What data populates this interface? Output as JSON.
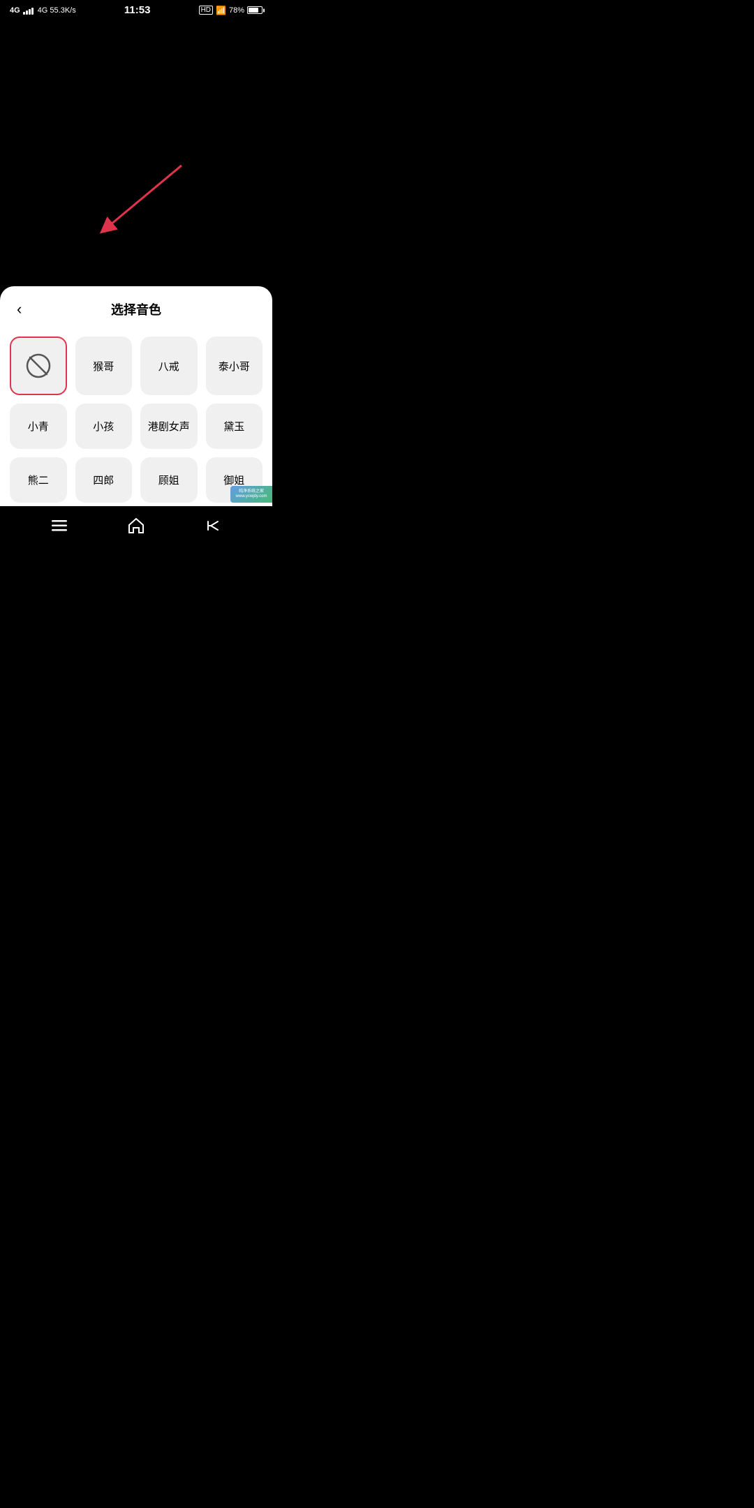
{
  "statusBar": {
    "left": "4G  55.3K/s",
    "time": "11:53",
    "right": "HD  78%"
  },
  "sheet": {
    "title": "选择音色",
    "backLabel": "‹"
  },
  "voiceOptions": [
    {
      "id": "none",
      "label": "",
      "isNone": true,
      "selected": true
    },
    {
      "id": "monkey",
      "label": "猴哥",
      "isNone": false,
      "selected": false
    },
    {
      "id": "bajie",
      "label": "八戒",
      "isNone": false,
      "selected": false
    },
    {
      "id": "taixiaoge",
      "label": "泰小哥",
      "isNone": false,
      "selected": false
    },
    {
      "id": "xiaoqing",
      "label": "小青",
      "isNone": false,
      "selected": false
    },
    {
      "id": "xiaohai",
      "label": "小孩",
      "isNone": false,
      "selected": false
    },
    {
      "id": "gangju",
      "label": "港剧女声",
      "isNone": false,
      "selected": false
    },
    {
      "id": "daiyu",
      "label": "黛玉",
      "isNone": false,
      "selected": false
    },
    {
      "id": "xionger",
      "label": "熊二",
      "isNone": false,
      "selected": false
    },
    {
      "id": "silang",
      "label": "四郎",
      "isNone": false,
      "selected": false
    },
    {
      "id": "gujie",
      "label": "顾姐",
      "isNone": false,
      "selected": false
    },
    {
      "id": "yujie",
      "label": "御姐",
      "isNone": false,
      "selected": false
    }
  ],
  "nav": {
    "menu": "☰",
    "home": "⌂",
    "back": "↩"
  },
  "arrow": {
    "color": "#e0334c"
  }
}
